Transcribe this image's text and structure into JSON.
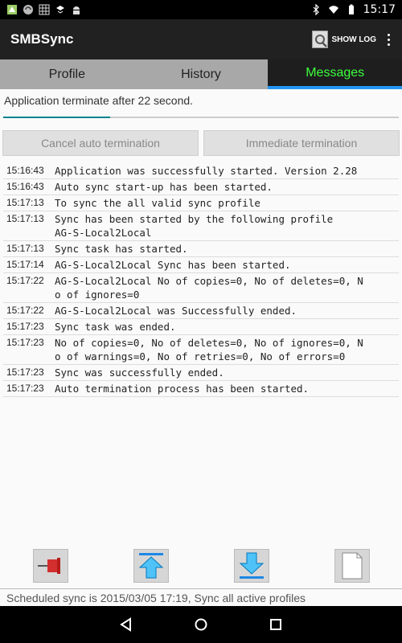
{
  "status_bar": {
    "time": "15:17",
    "left_icons": [
      "app-icon",
      "sync-icon",
      "grid-icon",
      "dropbox-icon",
      "android-icon"
    ],
    "right_icons": [
      "bluetooth-icon",
      "wifi-icon",
      "battery-icon"
    ]
  },
  "action_bar": {
    "title": "SMBSync",
    "show_log_label": "SHOW LOG"
  },
  "tabs": [
    {
      "label": "Profile",
      "active": false
    },
    {
      "label": "History",
      "active": false
    },
    {
      "label": "Messages",
      "active": true
    }
  ],
  "termination": {
    "message": "Application terminate after 22 second.",
    "progress": 0.27,
    "cancel_label": "Cancel auto termination",
    "immediate_label": "Immediate termination"
  },
  "log": [
    {
      "time": "15:16:43",
      "msg": "Application was successfully started. Version 2.28"
    },
    {
      "time": "15:16:43",
      "msg": "Auto sync start-up has been started."
    },
    {
      "time": "15:17:13",
      "msg": "To sync the all valid sync profile"
    },
    {
      "time": "15:17:13",
      "msg": "Sync has been started by the following profile\nAG-S-Local2Local"
    },
    {
      "time": "15:17:13",
      "msg": "Sync task has started."
    },
    {
      "time": "15:17:14",
      "msg": "AG-S-Local2Local Sync has been started."
    },
    {
      "time": "15:17:22",
      "msg": "AG-S-Local2Local No of copies=0, No of deletes=0, N\no of ignores=0"
    },
    {
      "time": "15:17:22",
      "msg": "AG-S-Local2Local was Successfully ended."
    },
    {
      "time": "15:17:23",
      "msg": "Sync task was ended."
    },
    {
      "time": "15:17:23",
      "msg": "No of copies=0, No of deletes=0, No of ignores=0, N\no of warnings=0, No of retries=0, No of errors=0"
    },
    {
      "time": "15:17:23",
      "msg": "Sync was successfully ended."
    },
    {
      "time": "15:17:23",
      "msg": "Auto termination process has been started."
    }
  ],
  "toolbar": {
    "buttons": [
      "pin-icon",
      "scroll-top-icon",
      "scroll-bottom-icon",
      "blank-document-icon"
    ]
  },
  "bottom_message": "Scheduled sync is 2015/03/05 17:19, Sync all active profiles",
  "nav_bar": {
    "buttons": [
      "back-icon",
      "home-icon",
      "recents-icon"
    ]
  },
  "colors": {
    "active_tab_text": "#3cff3c",
    "active_tab_underline": "#2196f3",
    "progress": "#00838f",
    "action_bar": "#212121"
  }
}
